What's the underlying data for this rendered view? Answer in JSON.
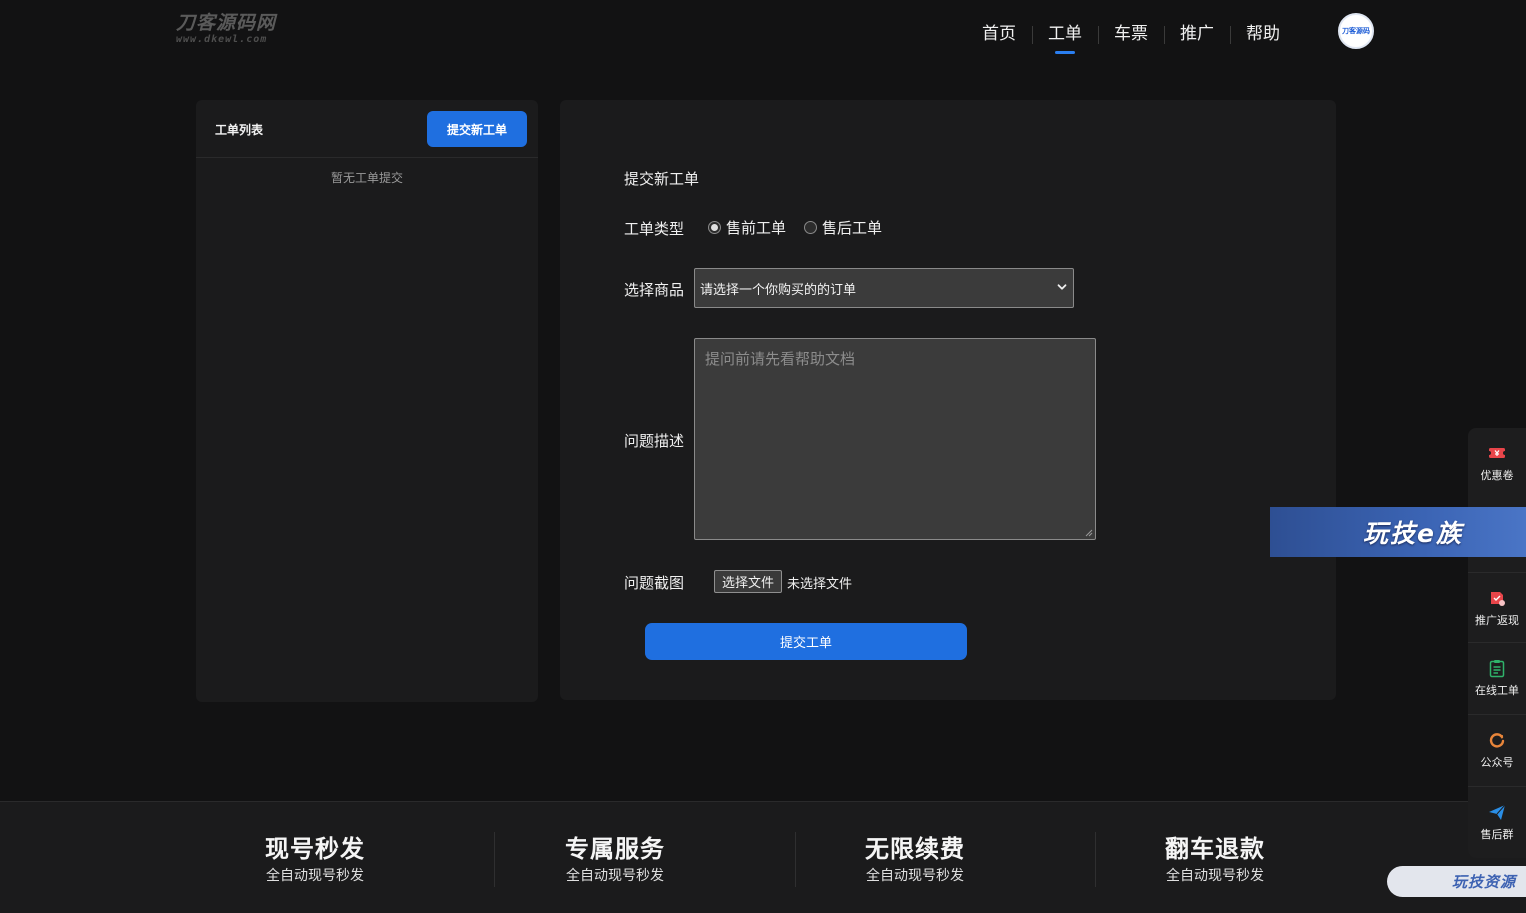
{
  "header": {
    "logo_main": "刀客源码网",
    "logo_sub": "www.dkewl.com",
    "nav": [
      {
        "label": "首页",
        "active": false
      },
      {
        "label": "工单",
        "active": true
      },
      {
        "label": "车票",
        "active": false
      },
      {
        "label": "推广",
        "active": false
      },
      {
        "label": "帮助",
        "active": false
      }
    ],
    "avatar_text": "刀客源码"
  },
  "left_panel": {
    "title": "工单列表",
    "new_ticket_label": "提交新工单",
    "empty_text": "暂无工单提交"
  },
  "form": {
    "title": "提交新工单",
    "type_label": "工单类型",
    "type_options": [
      {
        "label": "售前工单",
        "checked": true
      },
      {
        "label": "售后工单",
        "checked": false
      }
    ],
    "product_label": "选择商品",
    "product_selected": "请选择一个你购买的的订单",
    "description_label": "问题描述",
    "description_placeholder": "提问前请先看帮助文档",
    "screenshot_label": "问题截图",
    "file_button_label": "选择文件",
    "file_status": "未选择文件",
    "submit_label": "提交工单"
  },
  "footer": {
    "features": [
      {
        "title": "现号秒发",
        "subtitle": "全自动现号秒发"
      },
      {
        "title": "专属服务",
        "subtitle": "全自动现号秒发"
      },
      {
        "title": "无限续费",
        "subtitle": "全自动现号秒发"
      },
      {
        "title": "翻车退款",
        "subtitle": "全自动现号秒发"
      }
    ]
  },
  "side_bar": {
    "items": [
      {
        "label": "优惠卷",
        "icon": "coupon-icon",
        "color": "#e8454a"
      },
      {
        "label": "推广返现",
        "icon": "gift-icon",
        "color": "#e8454a"
      },
      {
        "label": "在线工单",
        "icon": "clipboard-icon",
        "color": "#2fb36a"
      },
      {
        "label": "公众号",
        "icon": "refresh-icon",
        "color": "#e8853a"
      },
      {
        "label": "售后群",
        "icon": "paper-plane-icon",
        "color": "#2a8ee6"
      }
    ]
  },
  "watermarks": {
    "banner": "玩技e族",
    "bottom": "玩技资源"
  },
  "colors": {
    "accent": "#1f6fe0",
    "background": "#121213",
    "panel": "#1b1b1c"
  }
}
